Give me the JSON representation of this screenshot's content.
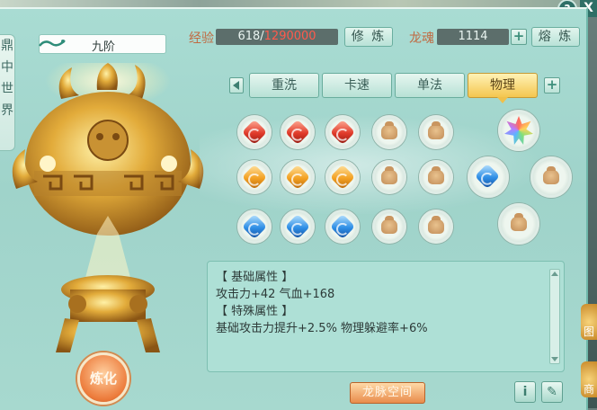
{
  "sidebar": {
    "chars": [
      "鼎",
      "中",
      "世",
      "界"
    ]
  },
  "header": {
    "level_label": "九阶",
    "exp_label": "经验",
    "exp_current": "618",
    "exp_separator": "/",
    "exp_max": "1290000",
    "train_button": "修 炼",
    "soul_label": "龙魂",
    "soul_value": "1114",
    "smelt_button": "熔 炼"
  },
  "tabs": [
    "重洗",
    "卡速",
    "单法",
    "物理"
  ],
  "active_tab": "物理",
  "slot_rows": {
    "row1": [
      "red",
      "red",
      "red",
      "bag",
      "bag"
    ],
    "row2": [
      "orange",
      "orange",
      "orange",
      "bag",
      "bag"
    ],
    "row3": [
      "blue",
      "blue",
      "blue",
      "bag",
      "bag"
    ]
  },
  "special_slots": [
    "rainbow-star",
    "blue",
    "bag",
    "bag"
  ],
  "info": {
    "basic_title": "【 基础属性 】",
    "basic_line": "攻击力+42 气血+168",
    "special_title": "【 特殊属性 】",
    "special_line": "基础攻击力提升+2.5% 物理躲避率+6%"
  },
  "footer": {
    "meridian_button": "龙脉空间",
    "info_button": "i",
    "edit_button": "✎"
  },
  "refine_button": "炼化",
  "help": "?",
  "close": "X",
  "right_side": [
    "图",
    "商"
  ],
  "colors": {
    "accent": "#f4c64f",
    "exp_max": "#ff5a4c",
    "panel": "#a9dcd3"
  }
}
